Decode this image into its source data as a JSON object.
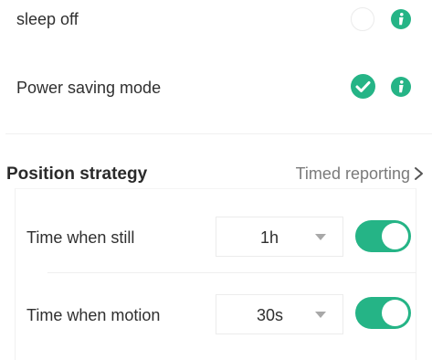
{
  "sleep": {
    "label": "sleep off",
    "selected": false
  },
  "power_saving": {
    "label": "Power saving mode",
    "selected": true
  },
  "position_strategy": {
    "label": "Position strategy",
    "value": "Timed reporting"
  },
  "still": {
    "label": "Time when still",
    "select_value": "1h",
    "enabled": true
  },
  "motion": {
    "label": "Time when motion",
    "select_value": "30s",
    "enabled": true
  },
  "colors": {
    "accent": "#25b486",
    "text": "#2f2f2f",
    "muted_text": "#7a7a7a"
  },
  "icons": {
    "info": "info-icon",
    "check": "check-icon",
    "chevron": "chevron-right-icon",
    "caret": "caret-down-icon"
  }
}
